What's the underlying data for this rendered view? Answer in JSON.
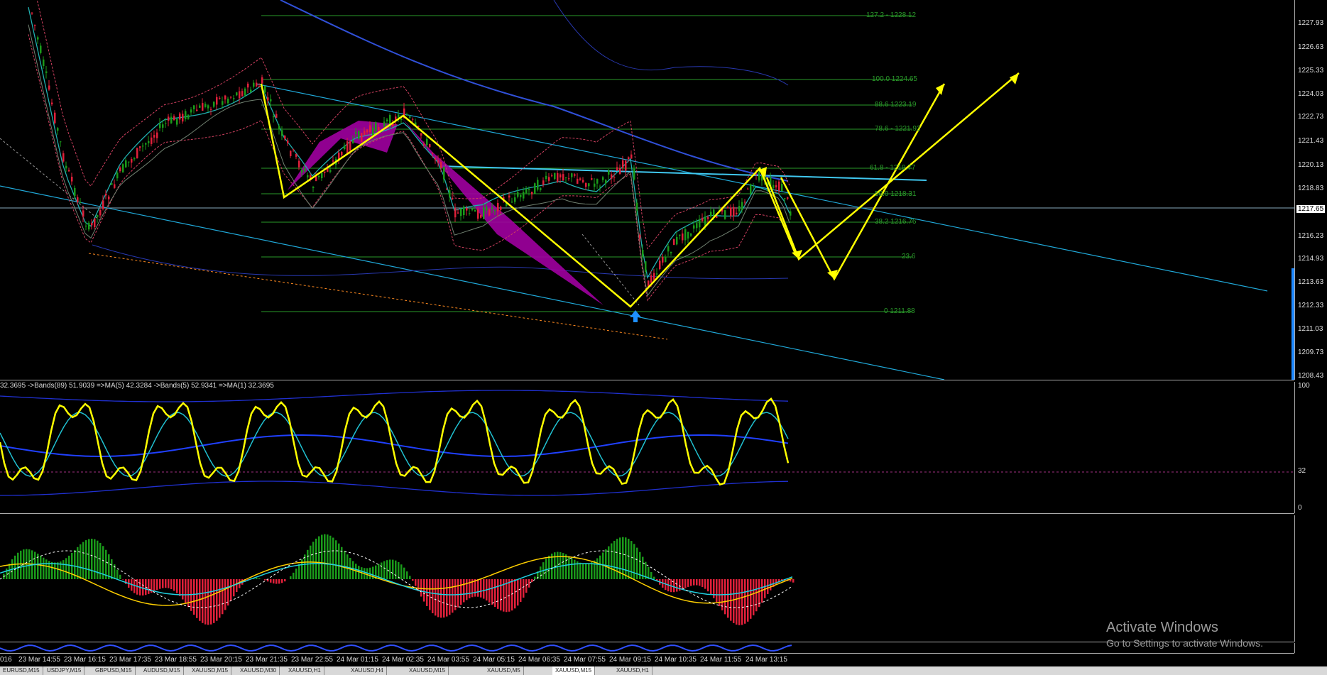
{
  "colors": {
    "bull": "#1a9a1a",
    "bear": "#e0203a",
    "pattern": "#ffff00",
    "harmonic": "#a000a0",
    "channel": "#20a8d8",
    "ma": "#3050d8",
    "fib": "#2a9a2a",
    "arrow": "#1e90ff"
  },
  "main_chart": {
    "price_ticks": [
      "1227.93",
      "1226.63",
      "1225.33",
      "1224.03",
      "1222.73",
      "1221.43",
      "1220.13",
      "1218.83",
      "1216.23",
      "1214.93",
      "1213.63",
      "1212.33",
      "1211.03",
      "1209.73",
      "1208.43"
    ],
    "current_price": "1217.65",
    "fib_levels": [
      "127.2 - 1228.12",
      "100.0 1224.65",
      "88.6 1223.19",
      "78.6 - 1221.92",
      "61.8 - 1219.77",
      "50.0 1218.31",
      "38.2 1216.76",
      "23.6",
      "0 1211.88"
    ],
    "buy_arrow_icon": "up-arrow-icon"
  },
  "oscillator1": {
    "label": "32.3695 ->Bands(89) 51.9039 =>MA(5) 42.3284 ->Bands(5) 52.9341 =>MA(1) 32.3695",
    "scale": [
      "100",
      "32",
      "0"
    ]
  },
  "time_axis": [
    "016",
    "23 Mar 14:55",
    "23 Mar 16:15",
    "23 Mar 17:35",
    "23 Mar 18:55",
    "23 Mar 20:15",
    "23 Mar 21:35",
    "23 Mar 22:55",
    "24 Mar 01:15",
    "24 Mar 02:35",
    "24 Mar 03:55",
    "24 Mar 05:15",
    "24 Mar 06:35",
    "24 Mar 07:55",
    "24 Mar 09:15",
    "24 Mar 10:35",
    "24 Mar 11:55",
    "24 Mar 13:15"
  ],
  "tabs": [
    "EURUSD,M15",
    "USDJPY,M15",
    "GBPUSD,M15",
    "AUDUSD,M15",
    "XAUUSD,M15",
    "XAUUSD,M30",
    "XAUUSD,H1",
    "XAUUSD,H4",
    "XAUUSD,M15",
    "XAUUSD,M5",
    "XAUUSD,M15",
    "XAUUSD,H1"
  ],
  "active_tab": 10,
  "watermark": {
    "title": "Activate Windows",
    "subtitle": "Go to Settings to activate Windows."
  }
}
